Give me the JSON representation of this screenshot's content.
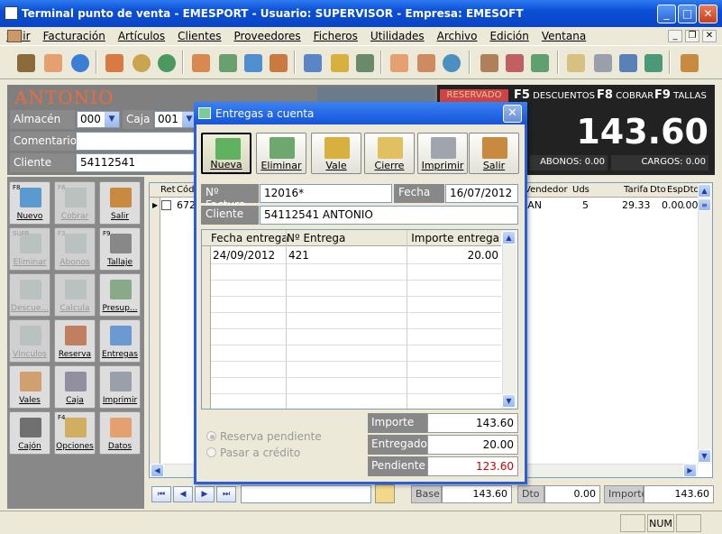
{
  "window": {
    "title": "Terminal punto de venta - EMESPORT  -  Usuario: SUPERVISOR  -  Empresa: EMESOFT"
  },
  "menu": [
    "Salir",
    "Facturación",
    "Artículos",
    "Clientes",
    "Proveedores",
    "Ficheros",
    "Utilidades",
    "Archivo",
    "Edición",
    "Ventana"
  ],
  "header": {
    "customer_name": "ANTONIO",
    "almacen_label": "Almacén",
    "almacen_value": "000",
    "caja_label": "Caja",
    "caja_value": "001",
    "comentario_label": "Comentario",
    "cliente_label": "Cliente",
    "cliente_value": "54112541"
  },
  "totals": {
    "reservado": "RESERVADO",
    "f5": "F5",
    "f5_label": "DESCUENTOS",
    "f8": "F8",
    "f8_label": "COBRAR",
    "f9": "F9",
    "f9_label": "TALLAS",
    "total": "143.60",
    "abonos": "ABONOS: 0.00",
    "cargos": "CARGOS: 0.00"
  },
  "keypad": [
    {
      "fk": "F8",
      "label": "Nuevo"
    },
    {
      "fk": "F8",
      "label": "Cobrar"
    },
    {
      "fk": "",
      "label": "Salir"
    },
    {
      "fk": "SUPR",
      "label": "Eliminar"
    },
    {
      "fk": "F3",
      "label": "Abonos"
    },
    {
      "fk": "F9",
      "label": "Tallaje"
    },
    {
      "fk": "",
      "label": "Descue..."
    },
    {
      "fk": "",
      "label": "Calcula"
    },
    {
      "fk": "",
      "label": "Presup..."
    },
    {
      "fk": "",
      "label": "Vínculos"
    },
    {
      "fk": "",
      "label": "Reserva"
    },
    {
      "fk": "",
      "label": "Entregas"
    },
    {
      "fk": "",
      "label": "Vales"
    },
    {
      "fk": "",
      "label": "Caja"
    },
    {
      "fk": "",
      "label": "Imprimir"
    },
    {
      "fk": "",
      "label": "Cajón"
    },
    {
      "fk": "F4",
      "label": "Opciones"
    },
    {
      "fk": "",
      "label": "Datos"
    }
  ],
  "grid": {
    "headers": {
      "ret": "Ret",
      "cod": "Cód",
      "vendedor": "Vendedor",
      "uds": "Uds",
      "tarifa": "Tarifa",
      "dto": "Dto",
      "espdto": "EspDto"
    },
    "row": {
      "cod": "672",
      "vendedor": "IAN",
      "uds": "5",
      "tarifa": "29.33",
      "dto": "0.00",
      "espdto": ".00"
    }
  },
  "bottom": {
    "base_label": "Base",
    "base_value": "143.60",
    "dto_label": "Dto",
    "dto_value": "0.00",
    "importe_label": "Importe",
    "importe_value": "143.60"
  },
  "status": {
    "num": "NUM"
  },
  "dialog": {
    "title": "Entregas a cuenta",
    "buttons": [
      "Nueva",
      "Eliminar",
      "Vale",
      "Cierre",
      "Imprimir",
      "Salir"
    ],
    "factura_label": "Nº Factura",
    "factura_value": "12016*",
    "fecha_label": "Fecha",
    "fecha_value": "16/07/2012",
    "cliente_label": "Cliente",
    "cliente_value": "54112541 ANTONIO",
    "grid_headers": [
      "Fecha entrega",
      "Nº Entrega",
      "Importe entrega"
    ],
    "rows": [
      {
        "fecha": "24/09/2012",
        "num": "421",
        "importe": "20.00"
      }
    ],
    "radio_reserva": "Reserva pendiente",
    "radio_credito": "Pasar a crédito",
    "importe_label": "Importe",
    "importe_value": "143.60",
    "entregado_label": "Entregado",
    "entregado_value": "20.00",
    "pendiente_label": "Pendiente",
    "pendiente_value": "123.60"
  },
  "colors": {
    "accent": "#0a4fd6",
    "pendiente": "#d00000",
    "name": "#f06a38"
  }
}
